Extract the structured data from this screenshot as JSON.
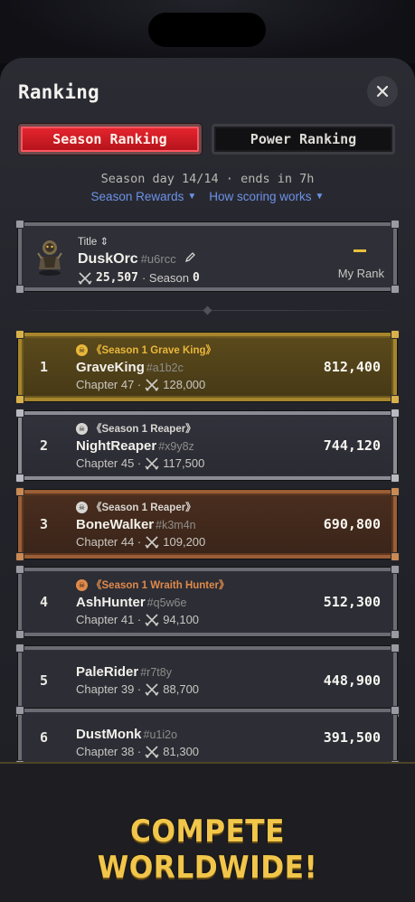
{
  "sheet": {
    "title": "Ranking",
    "close_icon": "close-icon"
  },
  "tabs": [
    {
      "label": "Season Ranking",
      "active": true
    },
    {
      "label": "Power Ranking",
      "active": false
    }
  ],
  "season": {
    "status": "Season day 14/14 · ends in 7h",
    "rewards_link": "Season Rewards",
    "scoring_link": "How scoring works",
    "link_arrow": "▼"
  },
  "my_rank": {
    "title_label": "Title",
    "title_arrows": "⇕",
    "name": "DuskOrc",
    "tag": "#u6rcc",
    "power": "25,507",
    "season_label": "· Season",
    "season_value": "0",
    "rank_label": "My Rank",
    "rank_value_color": "#e8c13a"
  },
  "rows": [
    {
      "rank": "1",
      "title": "《Season 1 Grave King》",
      "title_color": "#e9b73a",
      "name": "GraveKing",
      "tag": "#a1b2c",
      "chapter": "Chapter 47 ·",
      "power": "128,000",
      "score": "812,400",
      "style": "gold"
    },
    {
      "rank": "2",
      "title": "《Season 1 Reaper》",
      "title_color": "#d8d6d2",
      "name": "NightReaper",
      "tag": "#x9y8z",
      "chapter": "Chapter 45 ·",
      "power": "117,500",
      "score": "744,120",
      "style": "silver"
    },
    {
      "rank": "3",
      "title": "《Season 1 Reaper》",
      "title_color": "#d8d6d2",
      "name": "BoneWalker",
      "tag": "#k3m4n",
      "chapter": "Chapter 44 ·",
      "power": "109,200",
      "score": "690,800",
      "style": "bronze"
    },
    {
      "rank": "4",
      "title": "《Season 1 Wraith Hunter》",
      "title_color": "#e08a4a",
      "name": "AshHunter",
      "tag": "#q5w6e",
      "chapter": "Chapter 41 ·",
      "power": "94,100",
      "score": "512,300",
      "style": "plain"
    },
    {
      "rank": "5",
      "title": "",
      "title_color": "",
      "name": "PaleRider",
      "tag": "#r7t8y",
      "chapter": "Chapter 39 ·",
      "power": "88,700",
      "score": "448,900",
      "style": "plain"
    },
    {
      "rank": "6",
      "title": "",
      "title_color": "",
      "name": "DustMonk",
      "tag": "#u1i2o",
      "chapter": "Chapter 38 ·",
      "power": "81,300",
      "score": "391,500",
      "style": "plain"
    }
  ],
  "footer": {
    "tagline": "COMPETE WORLDWIDE!"
  },
  "colors": {
    "accent_red": "#e8262f",
    "link_blue": "#6d92e8",
    "gold": "#f2c64a"
  }
}
